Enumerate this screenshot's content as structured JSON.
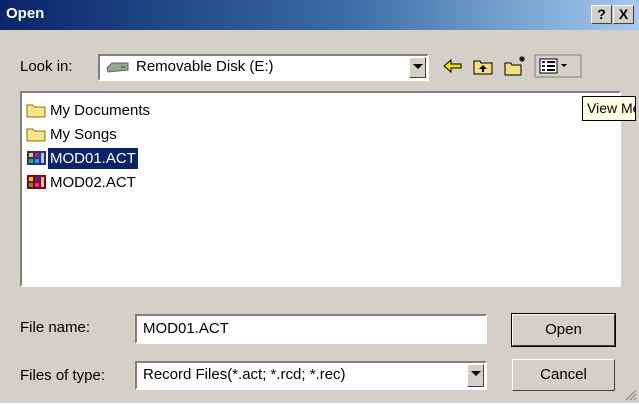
{
  "title": "Open",
  "titlebar": {
    "help": "?",
    "close": "X"
  },
  "look_in": {
    "label": "Look in:",
    "value": "Removable Disk (E:)"
  },
  "files": [
    {
      "name": "My Documents",
      "type": "folder",
      "selected": false
    },
    {
      "name": "My Songs",
      "type": "folder",
      "selected": false
    },
    {
      "name": "MOD01.ACT",
      "type": "act-file",
      "selected": true
    },
    {
      "name": "MOD02.ACT",
      "type": "act-file",
      "selected": false
    }
  ],
  "tooltip": "View Menu",
  "file_name": {
    "label": "File name:",
    "value": "MOD01.ACT"
  },
  "file_type": {
    "label": "Files of type:",
    "value": "Record Files(*.act; *.rcd; *.rec)"
  },
  "buttons": {
    "open": "Open",
    "cancel": "Cancel"
  },
  "colors": {
    "title_start": "#0a246a",
    "title_end": "#a6caf0",
    "selection": "#0a246a",
    "dialog_bg": "#d4d0c8",
    "tooltip_bg": "#ffffe1"
  }
}
